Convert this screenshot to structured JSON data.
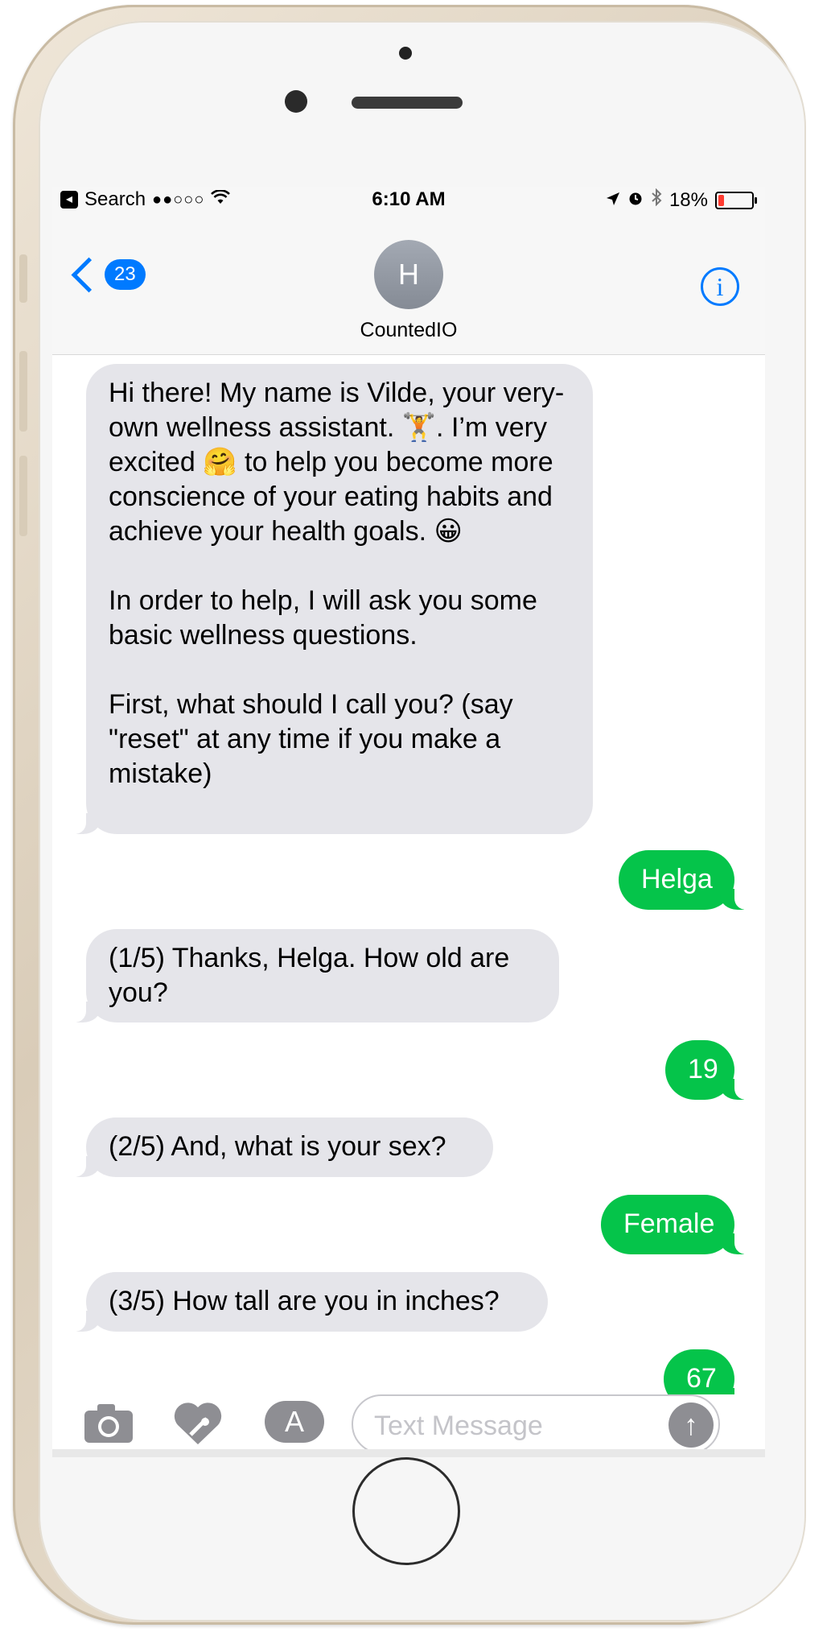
{
  "status_bar": {
    "back_app_label": "Search",
    "signal": "●●○○○",
    "time": "6:10 AM",
    "battery_percent_label": "18%",
    "battery_level": 0.18,
    "icons": [
      "wifi-icon",
      "location-arrow-icon",
      "alarm-icon",
      "bluetooth-icon",
      "battery-icon"
    ]
  },
  "nav": {
    "unread_count": "23",
    "avatar_initial": "H",
    "contact_name": "CountedIO",
    "info_glyph": "i"
  },
  "messages": [
    {
      "direction": "incoming",
      "paragraphs": [
        "Hi there! My name is Vilde, your very-own wellness assistant. 🏋. I’m very excited 🤗 to help you become more conscience of your eating habits and achieve your health goals. 😀",
        "In order to help, I will ask you some basic wellness questions.",
        "First, what should I call you? (say \"reset\" at any time if you make a mistake)"
      ]
    },
    {
      "direction": "outgoing",
      "text": "Helga"
    },
    {
      "direction": "incoming",
      "text": "(1/5) Thanks, Helga. How old are you?"
    },
    {
      "direction": "outgoing",
      "text": "19"
    },
    {
      "direction": "incoming",
      "text": "(2/5) And, what is your sex?"
    },
    {
      "direction": "outgoing",
      "text": "Female"
    },
    {
      "direction": "incoming",
      "text": "(3/5) How tall are you in inches?"
    },
    {
      "direction": "outgoing",
      "text": "67"
    }
  ],
  "input_bar": {
    "placeholder": "Text Message",
    "value": "",
    "icons": [
      "camera-icon",
      "heart-icon",
      "app-store-icon",
      "send-arrow-icon"
    ]
  },
  "colors": {
    "ios_blue": "#007aff",
    "incoming_bubble": "#e5e5ea",
    "outgoing_bubble": "#05c44a",
    "battery_low": "#ff3b30"
  }
}
